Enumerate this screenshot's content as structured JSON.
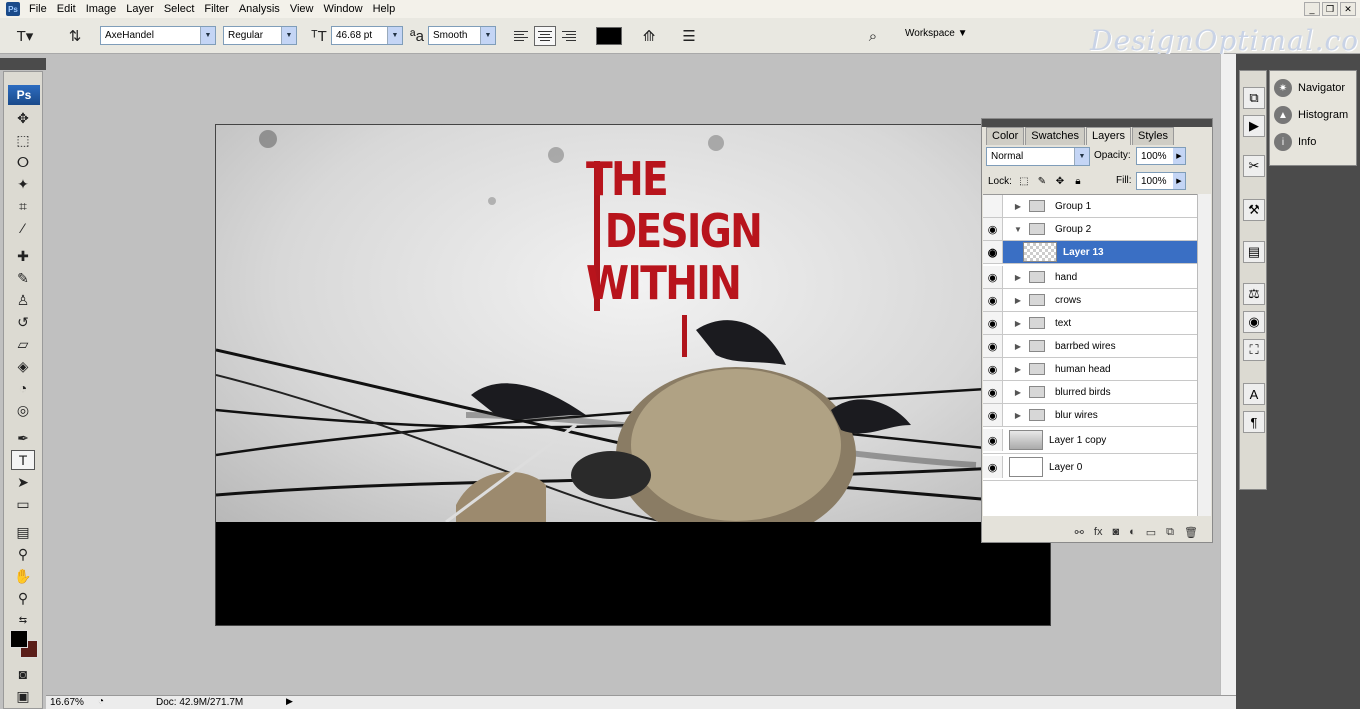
{
  "menubar": {
    "app_icon": "Ps",
    "items": [
      "File",
      "Edit",
      "Image",
      "Layer",
      "Select",
      "Filter",
      "Analysis",
      "View",
      "Window",
      "Help"
    ],
    "window_controls": [
      "_",
      "❐",
      "✕"
    ]
  },
  "options": {
    "font_family": "AxeHandel",
    "font_style": "Regular",
    "font_size": "46.68 pt",
    "antialias": "Smooth",
    "text_color": "#000000",
    "workspace_label": "Workspace"
  },
  "brand": {
    "watermark": "DesignOptimal.com"
  },
  "toolbox": {
    "logo": "Ps",
    "foreground_color": "#000000",
    "background_color": "#5a1e1a"
  },
  "document": {
    "title_lines": [
      "THE",
      "DESIGN",
      "WITHIN"
    ],
    "title_color": "#b8141c",
    "zoom_level": "16.67%",
    "doc_size": "Doc: 42.9M/271.7M"
  },
  "right_dock": {
    "panels": [
      {
        "label": "Navigator",
        "icon": "navigator-icon"
      },
      {
        "label": "Histogram",
        "icon": "histogram-icon"
      },
      {
        "label": "Info",
        "icon": "info-icon"
      }
    ]
  },
  "layers_panel": {
    "tabs": [
      "Color",
      "Swatches",
      "Layers",
      "Styles"
    ],
    "active_tab": "Layers",
    "blend_mode": "Normal",
    "opacity_label": "Opacity:",
    "opacity": "100%",
    "lock_label": "Lock:",
    "fill_label": "Fill:",
    "fill": "100%",
    "layers": [
      {
        "name": "Group 1",
        "type": "group",
        "visible": false,
        "expanded": false
      },
      {
        "name": "Group 2",
        "type": "group",
        "visible": true,
        "expanded": true
      },
      {
        "name": "Layer 13",
        "type": "layer",
        "visible": true,
        "selected": true
      },
      {
        "name": "hand",
        "type": "group",
        "visible": true
      },
      {
        "name": "crows",
        "type": "group",
        "visible": true
      },
      {
        "name": "text",
        "type": "group",
        "visible": true
      },
      {
        "name": "barrbed wires",
        "type": "group",
        "visible": true
      },
      {
        "name": "human head",
        "type": "group",
        "visible": true
      },
      {
        "name": "blurred birds",
        "type": "group",
        "visible": true
      },
      {
        "name": "blur wires",
        "type": "group",
        "visible": true
      },
      {
        "name": "Layer 1 copy",
        "type": "layer",
        "visible": true
      },
      {
        "name": "Layer 0",
        "type": "layer",
        "visible": true
      }
    ]
  }
}
